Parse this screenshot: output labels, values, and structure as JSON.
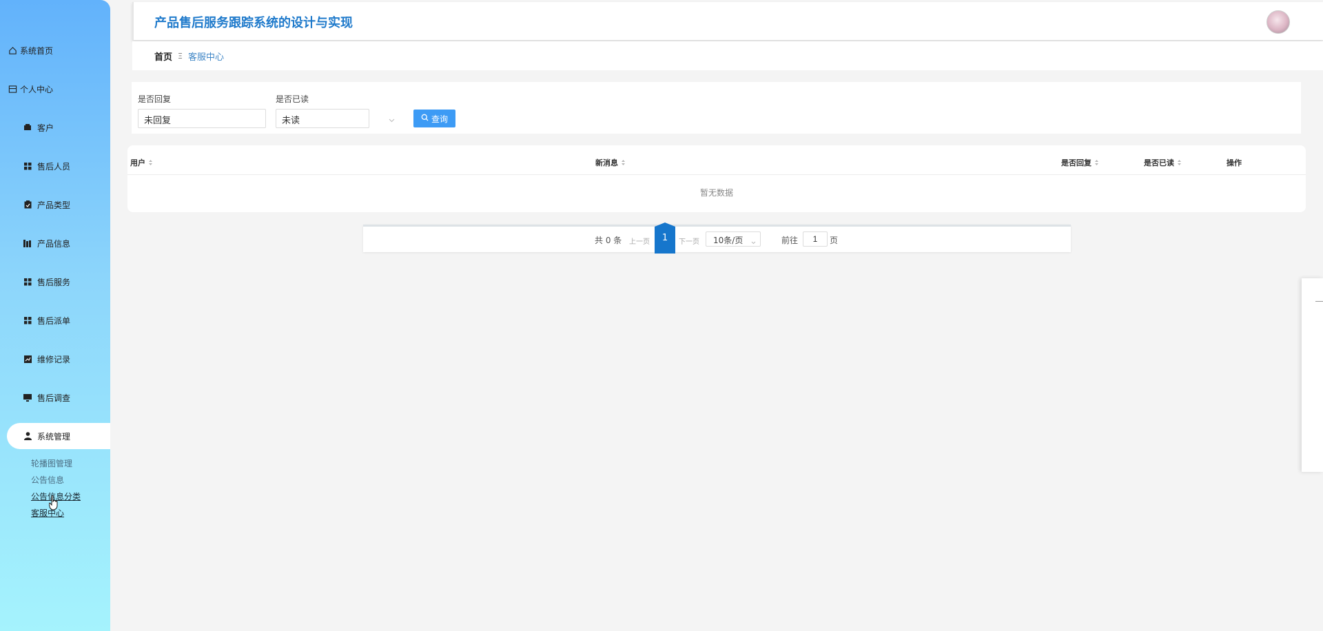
{
  "app": {
    "title": "产品售后服务跟踪系统的设计与实现"
  },
  "sidebar": {
    "items": [
      {
        "label": "系统首页",
        "icon": "home-icon"
      },
      {
        "label": "个人中心",
        "icon": "profile-icon"
      },
      {
        "label": "客户",
        "icon": "wallet-icon"
      },
      {
        "label": "售后人员",
        "icon": "grid-icon"
      },
      {
        "label": "产品类型",
        "icon": "clipboard-icon"
      },
      {
        "label": "产品信息",
        "icon": "library-icon"
      },
      {
        "label": "售后服务",
        "icon": "grid-icon"
      },
      {
        "label": "售后派单",
        "icon": "grid-icon"
      },
      {
        "label": "维修记录",
        "icon": "chart-icon"
      },
      {
        "label": "售后调查",
        "icon": "monitor-icon"
      },
      {
        "label": "系统管理",
        "icon": "user-icon",
        "active": true
      }
    ],
    "submenu": [
      {
        "label": "轮播图管理"
      },
      {
        "label": "公告信息"
      },
      {
        "label": "公告信息分类"
      },
      {
        "label": "客服中心"
      }
    ]
  },
  "breadcrumb": {
    "home": "首页",
    "separator": "Ξ",
    "current": "客服中心"
  },
  "filter": {
    "replied": {
      "label": "是否回复",
      "value": "未回复"
    },
    "read": {
      "label": "是否已读",
      "value": "未读"
    },
    "search_button": "查询"
  },
  "table": {
    "columns": [
      {
        "label": "用户",
        "sortable": true
      },
      {
        "label": "新消息",
        "sortable": true
      },
      {
        "label": "是否回复",
        "sortable": true
      },
      {
        "label": "是否已读",
        "sortable": true
      },
      {
        "label": "操作",
        "sortable": false
      }
    ],
    "empty_text": "暂无数据"
  },
  "pagination": {
    "total_text": "共 0 条",
    "prev": "上一页",
    "current_page": "1",
    "next": "下一页",
    "page_size": "10条/页",
    "goto_label": "前往",
    "goto_value": "1",
    "page_suffix": "页"
  },
  "colors": {
    "accent": "#1676cc",
    "title": "#1f7acb",
    "button": "#3d9bf5",
    "sidebar_top": "#62b2fb",
    "sidebar_bottom": "#a5f3fd"
  }
}
